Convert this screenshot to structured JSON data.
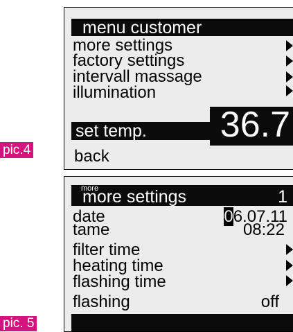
{
  "screen1": {
    "title": "menu customer",
    "items": [
      {
        "label": "more settings"
      },
      {
        "label": "factory settings"
      },
      {
        "label": "intervall massage"
      },
      {
        "label": "illumination"
      }
    ],
    "set_temp_label": "set temp.",
    "temperature": "36.7",
    "back_label": "back",
    "caption": "pic.4"
  },
  "screen2": {
    "small_label": "more",
    "title": "more settings",
    "page": "1",
    "date_label": "date",
    "date_cursor": "0",
    "date_rest": "6.07.11",
    "time_label": "tame",
    "time_value": "08:22",
    "items": [
      {
        "label": "filter time"
      },
      {
        "label": "heating time"
      },
      {
        "label": "flashing time"
      }
    ],
    "flashing_label": "flashing",
    "flashing_value": "off",
    "caption": "pic. 5"
  },
  "colors": {
    "caption_bg": "#d4147e",
    "display_bg": "#ececec",
    "bar_bg": "#0b0b0b"
  }
}
